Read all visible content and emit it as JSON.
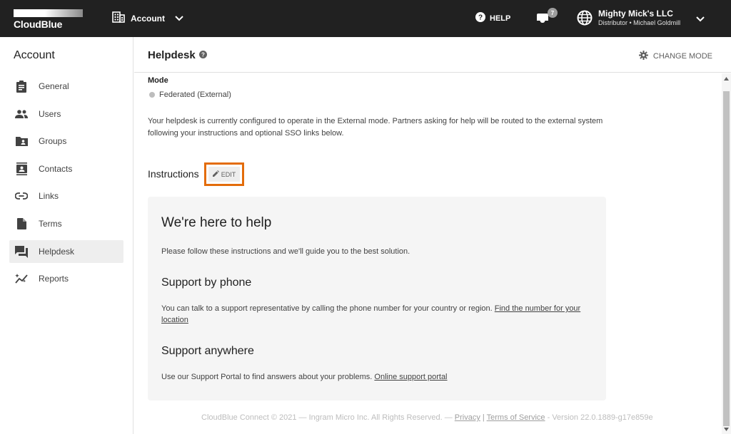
{
  "topbar": {
    "logo_text": "CloudBlue",
    "account_switcher_label": "Account",
    "help_label": "HELP",
    "inbox_count": "7",
    "company_name": "Mighty Mick's LLC",
    "company_role": "Distributor • Michael Goldmill"
  },
  "sidebar": {
    "title": "Account",
    "items": [
      {
        "label": "General",
        "icon": "clipboard-icon"
      },
      {
        "label": "Users",
        "icon": "users-icon"
      },
      {
        "label": "Groups",
        "icon": "folder-user-icon"
      },
      {
        "label": "Contacts",
        "icon": "contacts-icon"
      },
      {
        "label": "Links",
        "icon": "link-icon"
      },
      {
        "label": "Terms",
        "icon": "file-icon"
      },
      {
        "label": "Helpdesk",
        "icon": "chat-icon",
        "active": true
      },
      {
        "label": "Reports",
        "icon": "sparkle-chart-icon"
      }
    ]
  },
  "header": {
    "title": "Helpdesk",
    "change_mode_label": "CHANGE MODE"
  },
  "main": {
    "mode_label": "Mode",
    "mode_value": "Federated (External)",
    "description": "Your helpdesk is currently configured to operate in the External mode. Partners asking for help will be routed to the external system following your instructions and optional SSO links below.",
    "instructions_label": "Instructions",
    "edit_label": "EDIT",
    "card": {
      "heading": "We're here to help",
      "intro": "Please follow these instructions and we'll guide you to the best solution.",
      "phone_heading": "Support by phone",
      "phone_text": "You can talk to a support representative by calling the phone number for your country or region.",
      "phone_link": "Find the number for your location",
      "anywhere_heading": "Support anywhere",
      "anywhere_text": "Use our Support Portal to find answers about your problems.",
      "anywhere_link": "Online support portal"
    }
  },
  "footer": {
    "copyright": "CloudBlue Connect © 2021 — Ingram Micro Inc. All Rights Reserved. —",
    "privacy": "Privacy",
    "separator": "|",
    "terms": "Terms of Service",
    "version": "- Version 22.0.1889-g17e859e"
  }
}
